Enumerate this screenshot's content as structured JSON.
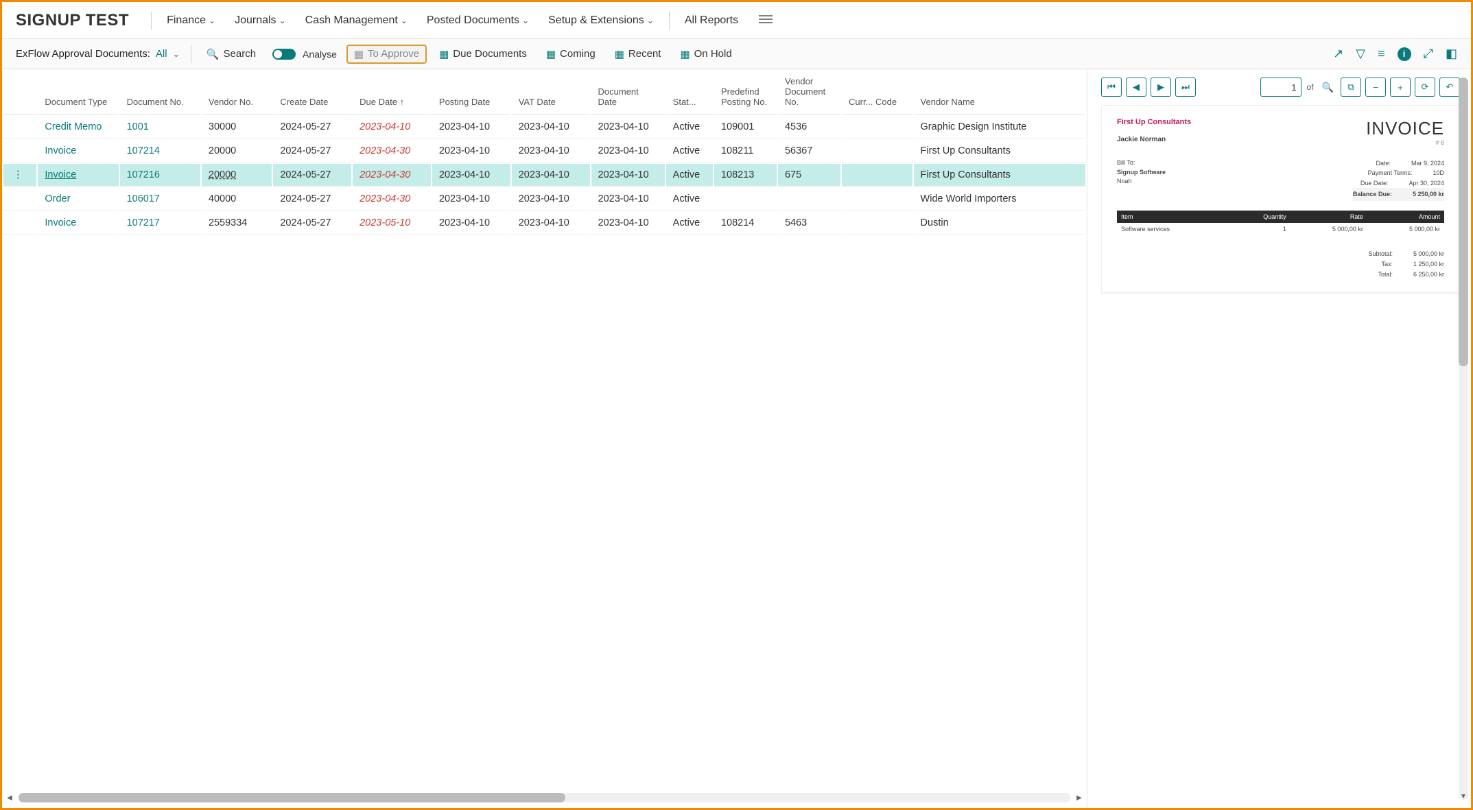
{
  "company": "SIGNUP TEST",
  "topnav": [
    "Finance",
    "Journals",
    "Cash Management",
    "Posted Documents",
    "Setup & Extensions"
  ],
  "topnav_right": "All Reports",
  "actionbar": {
    "label": "ExFlow Approval Documents:",
    "filter": "All",
    "search": "Search",
    "analyse": "Analyse",
    "to_approve": "To Approve",
    "due": "Due Documents",
    "coming": "Coming",
    "recent": "Recent",
    "on_hold": "On Hold"
  },
  "columns": [
    "Document Type",
    "Document No.",
    "Vendor No.",
    "Create Date",
    "Due Date ↑",
    "Posting Date",
    "VAT Date",
    "Document Date",
    "Stat...",
    "Predefind Posting No.",
    "Vendor Document No.",
    "Curr... Code",
    "Vendor Name"
  ],
  "rows": [
    {
      "doctype": "Credit Memo",
      "docno": "1001",
      "vendorno": "30000",
      "create": "2024-05-27",
      "due": "2023-04-10",
      "posting": "2023-04-10",
      "vat": "2023-04-10",
      "docdate": "2023-04-10",
      "status": "Active",
      "predef": "109001",
      "vdoc": "4536",
      "curr": "",
      "vendor": "Graphic Design Institute",
      "sel": false
    },
    {
      "doctype": "Invoice",
      "docno": "107214",
      "vendorno": "20000",
      "create": "2024-05-27",
      "due": "2023-04-30",
      "posting": "2023-04-10",
      "vat": "2023-04-10",
      "docdate": "2023-04-10",
      "status": "Active",
      "predef": "108211",
      "vdoc": "56367",
      "curr": "",
      "vendor": "First Up Consultants",
      "sel": false
    },
    {
      "doctype": "Invoice",
      "docno": "107216",
      "vendorno": "20000",
      "create": "2024-05-27",
      "due": "2023-04-30",
      "posting": "2023-04-10",
      "vat": "2023-04-10",
      "docdate": "2023-04-10",
      "status": "Active",
      "predef": "108213",
      "vdoc": "675",
      "curr": "",
      "vendor": "First Up Consultants",
      "sel": true
    },
    {
      "doctype": "Order",
      "docno": "106017",
      "vendorno": "40000",
      "create": "2024-05-27",
      "due": "2023-04-30",
      "posting": "2023-04-10",
      "vat": "2023-04-10",
      "docdate": "2023-04-10",
      "status": "Active",
      "predef": "",
      "vdoc": "",
      "curr": "",
      "vendor": "Wide World Importers",
      "sel": false
    },
    {
      "doctype": "Invoice",
      "docno": "107217",
      "vendorno": "2559334",
      "create": "2024-05-27",
      "due": "2023-05-10",
      "posting": "2023-04-10",
      "vat": "2023-04-10",
      "docdate": "2023-04-10",
      "status": "Active",
      "predef": "108214",
      "vdoc": "5463",
      "curr": "",
      "vendor": "Dustin",
      "sel": false
    }
  ],
  "preview": {
    "page": "1",
    "of": "of",
    "company": "First Up Consultants",
    "title": "INVOICE",
    "sub": "# 6",
    "name": "Jackie Norman",
    "billto_label": "Bill To:",
    "billto1": "Signup Software",
    "billto2": "Noah",
    "meta": [
      {
        "k": "Date:",
        "v": "Mar 9, 2024"
      },
      {
        "k": "Payment Terms:",
        "v": "10D"
      },
      {
        "k": "Due Date:",
        "v": "Apr 30, 2024"
      },
      {
        "k": "Balance Due:",
        "v": "5 250,00 kr",
        "bd": true
      }
    ],
    "th": [
      "Item",
      "Quantity",
      "Rate",
      "Amount"
    ],
    "lines": [
      {
        "item": "Software services",
        "qty": "1",
        "rate": "5 000,00 kr",
        "amt": "5 000,00 kr"
      }
    ],
    "totals": [
      {
        "k": "Subtotal:",
        "v": "5 000,00 kr"
      },
      {
        "k": "Tax:",
        "v": "1 250,00 kr"
      },
      {
        "k": "Total:",
        "v": "6 250,00 kr"
      }
    ]
  }
}
